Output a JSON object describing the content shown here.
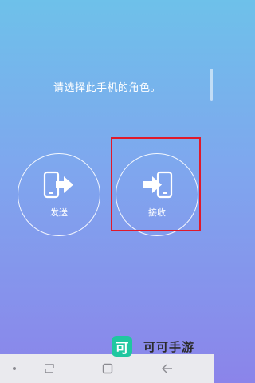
{
  "screen": {
    "prompt": "请选择此手机的角色。"
  },
  "roles": [
    {
      "label": "发送",
      "icon": "phone-send-icon"
    },
    {
      "label": "接收",
      "icon": "phone-receive-icon"
    }
  ],
  "highlight": {
    "target": "receive",
    "color": "#e0192b"
  },
  "nav_bar": {
    "buttons": [
      "dot-icon",
      "recents-icon",
      "home-icon",
      "back-icon"
    ]
  },
  "watermark": {
    "logo_char": "可",
    "text": "可可手游"
  },
  "colors": {
    "background_top": "#6ec1ea",
    "background_bottom": "#8b84ea",
    "accent": "#1fc7a0"
  }
}
